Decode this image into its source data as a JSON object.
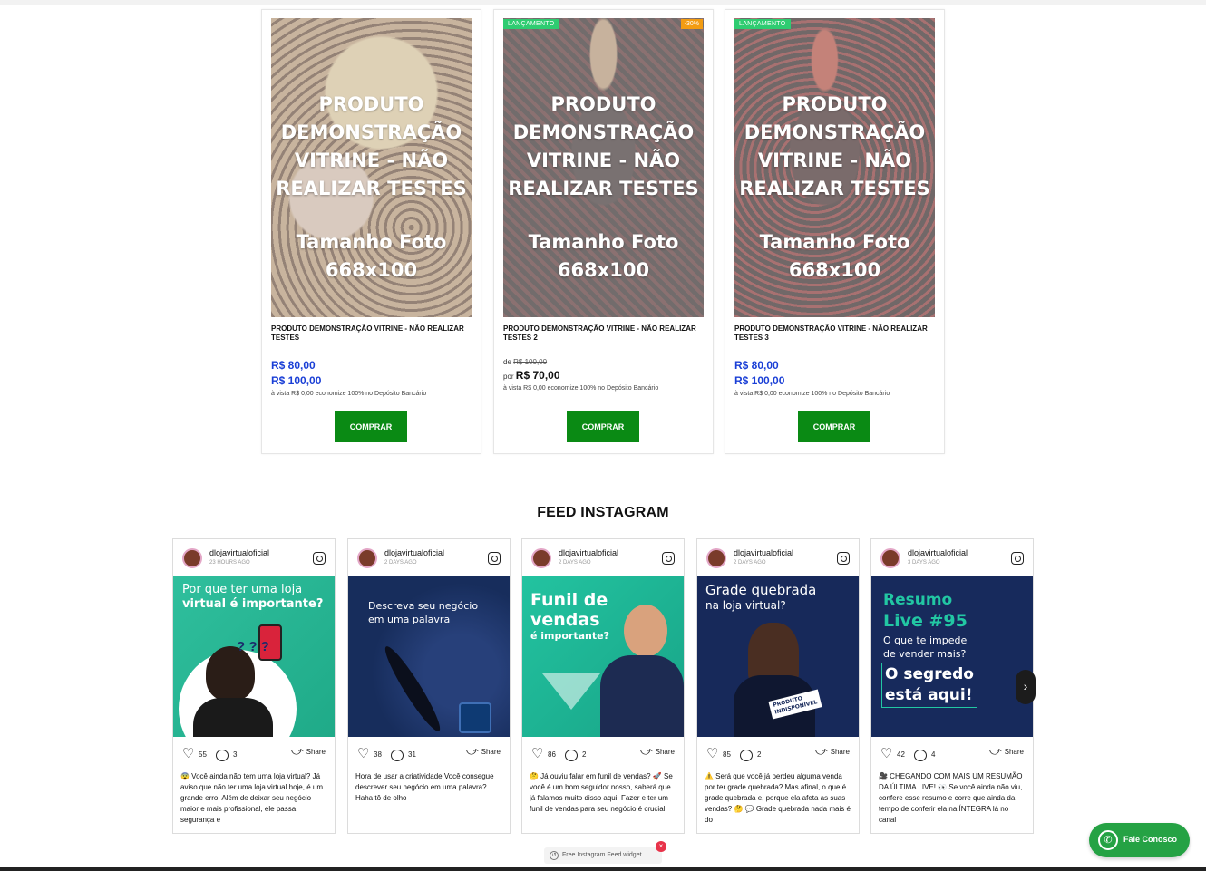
{
  "products": [
    {
      "overlay_line1": "PRODUTO",
      "overlay_line2": "DEMONSTRAÇÃO",
      "overlay_line3": "VITRINE - NÃO",
      "overlay_line4": "REALIZAR TESTES",
      "overlay_size1": "Tamanho Foto",
      "overlay_size2": "668x100",
      "title": "PRODUTO DEMONSTRAÇÃO VITRINE - NÃO REALIZAR TESTES",
      "price_a": "R$ 80,00",
      "price_b": "R$ 100,00",
      "vista": "à vista R$ 0,00 economize 100% no Depósito Bancário",
      "buy_label": "COMPRAR"
    },
    {
      "badge_new": "LANÇAMENTO",
      "badge_off": "-30%",
      "overlay_line1": "PRODUTO",
      "overlay_line2": "DEMONSTRAÇÃO",
      "overlay_line3": "VITRINE - NÃO",
      "overlay_line4": "REALIZAR TESTES",
      "overlay_size1": "Tamanho Foto",
      "overlay_size2": "668x100",
      "title": "PRODUTO DEMONSTRAÇÃO VITRINE - NÃO REALIZAR TESTES 2",
      "de_label": "de",
      "old_price": "R$ 100,00",
      "por_label": "por",
      "new_price": "R$ 70,00",
      "vista": "à vista R$ 0,00 economize 100% no Depósito Bancário",
      "buy_label": "COMPRAR"
    },
    {
      "badge_new": "LANÇAMENTO",
      "overlay_line1": "PRODUTO",
      "overlay_line2": "DEMONSTRAÇÃO",
      "overlay_line3": "VITRINE - NÃO",
      "overlay_line4": "REALIZAR TESTES",
      "overlay_size1": "Tamanho Foto",
      "overlay_size2": "668x100",
      "title": "PRODUTO DEMONSTRAÇÃO VITRINE - NÃO REALIZAR TESTES 3",
      "price_a": "R$ 80,00",
      "price_b": "R$ 100,00",
      "vista": "à vista R$ 0,00 economize 100% no Depósito Bancário",
      "buy_label": "COMPRAR"
    }
  ],
  "feed": {
    "title": "FEED INSTAGRAM",
    "share_label": "Share",
    "posts": [
      {
        "username": "dlojavirtualoficial",
        "ago": "23 HOURS AGO",
        "media_line1": "Por que ter uma loja",
        "media_line2": "virtual é importante?",
        "likes": "55",
        "comments": "3",
        "caption": "😨 Você ainda não tem uma loja virtual? Já aviso que não ter uma loja virtual hoje, é um grande erro. Além de deixar seu negócio maior e mais profissional, ele passa segurança e"
      },
      {
        "username": "dlojavirtualoficial",
        "ago": "2 DAYS AGO",
        "media_line1": "Descreva seu negócio",
        "media_line2": "em uma palavra",
        "likes": "38",
        "comments": "31",
        "caption": "Hora de usar a criatividade Você consegue descrever seu negócio em uma palavra? Haha tô de olho"
      },
      {
        "username": "dlojavirtualoficial",
        "ago": "2 DAYS AGO",
        "media_line1": "Funil de",
        "media_line2": "vendas",
        "media_line3": "é importante?",
        "likes": "86",
        "comments": "2",
        "caption": "🤔 Já ouviu falar em funil de vendas? 🚀 Se você é um bom seguidor nosso, saberá que já falamos muito disso aqui. Fazer e ter um funil de vendas para seu negócio é crucial"
      },
      {
        "username": "dlojavirtualoficial",
        "ago": "2 DAYS AGO",
        "media_line1": "Grade quebrada",
        "media_line2": "na loja virtual?",
        "media_tag1": "PRODUTO",
        "media_tag2": "INDISPONÍVEL",
        "likes": "85",
        "comments": "2",
        "caption": "⚠️ Será que você já perdeu alguma venda por ter grade quebrada? Mas afinal, o que é grade quebrada e, porque ela afeta as suas vendas? 🤔 💬 Grade quebrada nada mais é do"
      },
      {
        "username": "dlojavirtualoficial",
        "ago": "3 DAYS AGO",
        "media_line1": "Resumo",
        "media_line2": "Live #95",
        "media_line3": "O que te impede",
        "media_line4": "de vender mais?",
        "media_line5": "O segredo",
        "media_line6": "está aqui!",
        "likes": "42",
        "comments": "4",
        "caption": "🎥 CHEGANDO COM MAIS UM RESUMÃO DA ÚLTIMA LIVE! 👀 Se você ainda não viu, confere esse resumo e corre que ainda da tempo de conferir ela na ÍNTEGRA lá no canal"
      }
    ]
  },
  "widget": {
    "label": "Free Instagram Feed widget"
  },
  "whatsapp": {
    "label": "Fale Conosco"
  },
  "colors": {
    "price_blue": "#1a3fd6",
    "buy_green": "#0a8a14",
    "badge_new": "#2ecc71",
    "badge_off": "#f39c12",
    "whatsapp_green": "#25a244"
  }
}
